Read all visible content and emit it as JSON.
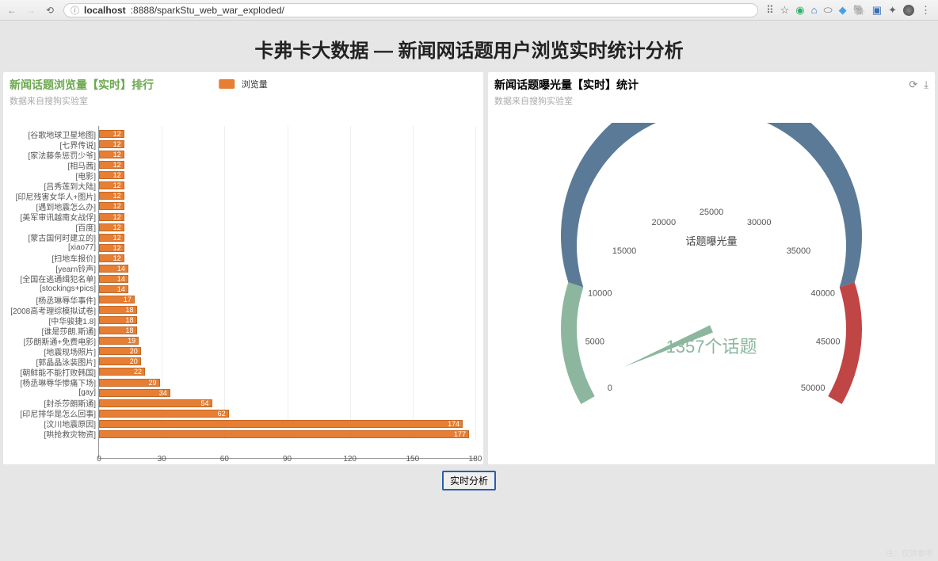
{
  "browser": {
    "url_host": "localhost",
    "url_rest": ":8888/sparkStu_web_war_exploded/"
  },
  "page_title": "卡弗卡大数据 — 新闻网话题用户浏览实时统计分析",
  "left_panel": {
    "title": "新闻话题浏览量【实时】排行",
    "title_color": "#6ca84f",
    "subtitle": "数据来自搜狗实验室",
    "legend": "浏览量"
  },
  "right_panel": {
    "title": "新闻话题曝光量【实时】统计",
    "subtitle": "数据来自搜狗实验室",
    "gauge_label": "话题曝光量",
    "gauge_value_text": "1357个话题"
  },
  "button_label": "实时分析",
  "watermark": "注：仅供参考",
  "chart_data": [
    {
      "type": "bar",
      "orientation": "horizontal",
      "title": "新闻话题浏览量【实时】排行",
      "xlabel": "",
      "ylabel": "",
      "xlim": [
        0,
        180
      ],
      "x_ticks": [
        0,
        30,
        60,
        90,
        120,
        150,
        180
      ],
      "categories": [
        "[谷歌地球卫星地图]",
        "[七界传说]",
        "[家法藤条惩罚少爷]",
        "[相马茜]",
        "[电影]",
        "[吕秀莲到大陆]",
        "[印尼残害女华人+图片]",
        "[遇到地震怎么办]",
        "[美军审讯越南女战俘]",
        "[百度]",
        "[蒙古国何时建立的]",
        "[xiao77]",
        "[扫地车报价]",
        "[yearn铃声]",
        "[全国在逃通缉犯名单]",
        "[stockings+pics]",
        "[杨丞琳辱华事件]",
        "[2008高考理综模拟试卷]",
        "[中华骏捷1.8]",
        "[谁是莎朗.斯通]",
        "[莎朗斯通+免费电影]",
        "[地震现场照片]",
        "[郭晶晶泳装图片]",
        "[朝鲜能不能打败韩国]",
        "[杨丞琳辱华惨痛下场]",
        "[gay]",
        "[封杀莎朗斯通]",
        "[印尼排华是怎么回事]",
        "[汶川地震原因]",
        "[哄抢救灾物资]"
      ],
      "values": [
        12,
        12,
        12,
        12,
        12,
        12,
        12,
        12,
        12,
        12,
        12,
        12,
        12,
        14,
        14,
        14,
        17,
        18,
        18,
        18,
        19,
        20,
        20,
        22,
        29,
        34,
        54,
        62,
        174,
        177
      ]
    },
    {
      "type": "gauge",
      "title": "新闻话题曝光量【实时】统计",
      "label": "话题曝光量",
      "min": 0,
      "max": 50000,
      "ticks": [
        0,
        5000,
        10000,
        15000,
        20000,
        25000,
        30000,
        35000,
        40000,
        45000,
        50000
      ],
      "segments": [
        {
          "from": 0,
          "to": 10000,
          "color": "#8cb79e"
        },
        {
          "from": 10000,
          "to": 40000,
          "color": "#5b7a97"
        },
        {
          "from": 40000,
          "to": 50000,
          "color": "#c04545"
        }
      ],
      "value": 1357,
      "value_text": "1357个话题"
    }
  ]
}
